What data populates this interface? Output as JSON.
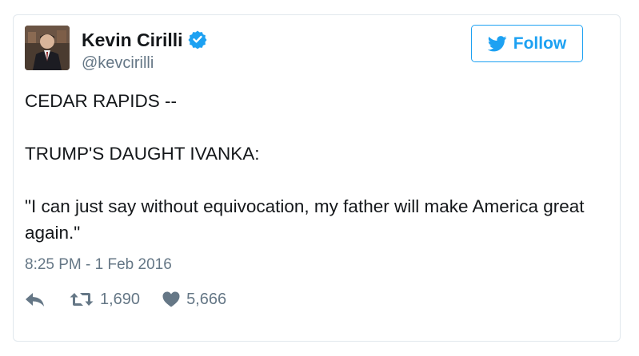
{
  "user": {
    "display_name": "Kevin Cirilli",
    "handle": "@kevcirilli",
    "verified": true
  },
  "follow_button": {
    "label": "Follow",
    "icon": "twitter-bird-icon"
  },
  "tweet": {
    "paragraphs": [
      "CEDAR RAPIDS --",
      "TRUMP'S DAUGHT IVANKA:",
      "\"I can just say without equivocation, my father will make America great again.\""
    ],
    "timestamp": "8:25 PM - 1 Feb 2016"
  },
  "actions": {
    "reply_icon": "reply-icon",
    "retweet_icon": "retweet-icon",
    "retweet_count": "1,690",
    "like_icon": "heart-icon",
    "like_count": "5,666"
  },
  "colors": {
    "accent": "#1da1f2",
    "text": "#14171a",
    "muted": "#657786",
    "border": "#e1e8ed"
  }
}
